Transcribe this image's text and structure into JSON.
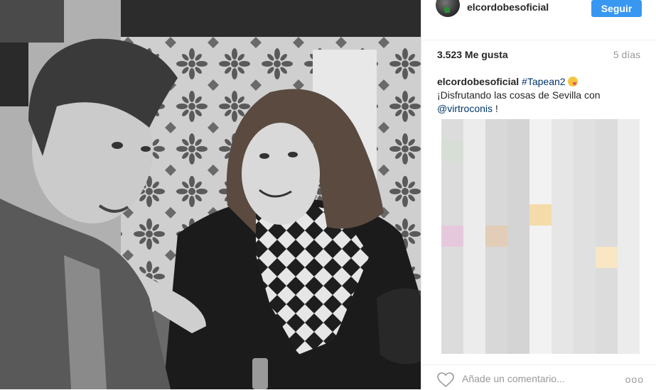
{
  "post": {
    "username": "elcordobesoficial",
    "follow_label": "Seguir",
    "likes": "3.523 Me gusta",
    "time_ago": "5 días",
    "caption": {
      "username": "elcordobesoficial",
      "hashtag": "#Tapean2",
      "text": "¡Disfrutando las cosas de Sevilla con",
      "mention": "@virtroconis",
      "suffix": " !"
    },
    "comment_placeholder": "Añade un comentario...",
    "more_label": "ooo"
  },
  "icons": {
    "like": "heart-icon",
    "more": "more-options-icon",
    "emoji": "grinning-squinting-face-tongue-emoji"
  },
  "colors": {
    "follow_button": "#3897f0",
    "link": "#003569",
    "muted": "#999999"
  }
}
